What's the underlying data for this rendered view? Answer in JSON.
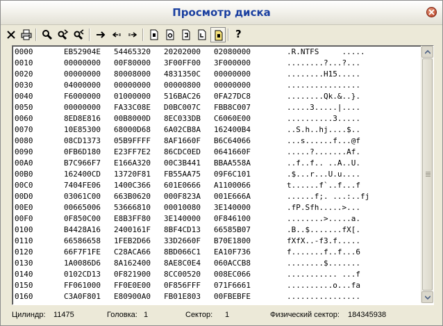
{
  "window": {
    "title": "Просмотр диска"
  },
  "toolbar": {
    "buttons": [
      {
        "name": "close-file-button",
        "icon": "x-icon"
      },
      {
        "name": "print-button",
        "icon": "printer-icon"
      },
      {
        "name": "search-button",
        "icon": "magnifier-icon"
      },
      {
        "name": "search-next-button",
        "icon": "magnifier-next-icon"
      },
      {
        "name": "search-prev-button",
        "icon": "magnifier-prev-icon"
      },
      {
        "name": "goto-button",
        "icon": "arrow-right-icon"
      },
      {
        "name": "back-button",
        "icon": "arrow-back-icon"
      },
      {
        "name": "forward-button",
        "icon": "arrow-forward-icon"
      },
      {
        "name": "view-mode-1-button",
        "icon": "page-icon"
      },
      {
        "name": "view-mode-2-button",
        "icon": "page-icon"
      },
      {
        "name": "view-mode-3-button",
        "icon": "page-icon"
      },
      {
        "name": "view-mode-4-button",
        "icon": "page-icon"
      },
      {
        "name": "view-mode-5-button",
        "icon": "page-icon"
      },
      {
        "name": "help-button",
        "icon": "question-icon"
      }
    ],
    "help_label": "?"
  },
  "hex_rows": [
    {
      "offset": "0000",
      "h1": "EB52904E",
      "h2": "54465320",
      "h3": "20202000",
      "h4": "02080000",
      "ascii": ".R.NTFS     ....."
    },
    {
      "offset": "0010",
      "h1": "00000000",
      "h2": "00F80000",
      "h3": "3F00FF00",
      "h4": "3F000000",
      "ascii": "........?...?..."
    },
    {
      "offset": "0020",
      "h1": "00000000",
      "h2": "80008000",
      "h3": "4831350C",
      "h4": "00000000",
      "ascii": "........H15....."
    },
    {
      "offset": "0030",
      "h1": "04000000",
      "h2": "00000000",
      "h3": "00000800",
      "h4": "00000000",
      "ascii": "................"
    },
    {
      "offset": "0040",
      "h1": "F6000000",
      "h2": "01000000",
      "h3": "516BAC26",
      "h4": "0FA27DC8",
      "ascii": "........Qk.&..}."
    },
    {
      "offset": "0050",
      "h1": "00000000",
      "h2": "FA33C08E",
      "h3": "D0BC007C",
      "h4": "FBB8C007",
      "ascii": ".....3.....|...."
    },
    {
      "offset": "0060",
      "h1": "8ED8E816",
      "h2": "00B8000D",
      "h3": "8EC033DB",
      "h4": "C6060E00",
      "ascii": "..........3....."
    },
    {
      "offset": "0070",
      "h1": "10E85300",
      "h2": "68000D68",
      "h3": "6A02CB8A",
      "h4": "162400B4",
      "ascii": "..S.h..hj....$.."
    },
    {
      "offset": "0080",
      "h1": "08CD1373",
      "h2": "05B9FFFF",
      "h3": "8AF1660F",
      "h4": "B6C64066",
      "ascii": "...s......f...@f"
    },
    {
      "offset": "0090",
      "h1": "0FB6D180",
      "h2": "E23FF7E2",
      "h3": "86CDC0ED",
      "h4": "0641660F",
      "ascii": ".....?.......Af."
    },
    {
      "offset": "00A0",
      "h1": "B7C966F7",
      "h2": "E166A320",
      "h3": "00C3B441",
      "h4": "BBAA558A",
      "ascii": "..f..f.. ..A..U."
    },
    {
      "offset": "00B0",
      "h1": "162400CD",
      "h2": "13720F81",
      "h3": "FB55AA75",
      "h4": "09F6C101",
      "ascii": ".$...r...U.u...."
    },
    {
      "offset": "00C0",
      "h1": "7404FE06",
      "h2": "1400C366",
      "h3": "601E0666",
      "h4": "A1100066",
      "ascii": "t......f`..f...f"
    },
    {
      "offset": "00D0",
      "h1": "03061C00",
      "h2": "663B0620",
      "h3": "000F823A",
      "h4": "001E666A",
      "ascii": "......f;. ...:..fj"
    },
    {
      "offset": "00E0",
      "h1": "00665006",
      "h2": "53666810",
      "h3": "00010080",
      "h4": "3E140000",
      "ascii": ".fP.Sfh.....>..."
    },
    {
      "offset": "00F0",
      "h1": "0F850C00",
      "h2": "E8B3FF80",
      "h3": "3E140000",
      "h4": "0F846100",
      "ascii": "........>.....a."
    },
    {
      "offset": "0100",
      "h1": "B4428A16",
      "h2": "2400161F",
      "h3": "8BF4CD13",
      "h4": "66585B07",
      "ascii": ".B..$.......fX[."
    },
    {
      "offset": "0110",
      "h1": "66586658",
      "h2": "1FEB2D66",
      "h3": "33D2660F",
      "h4": "B70E1800",
      "ascii": "fXfX..-f3.f....."
    },
    {
      "offset": "0120",
      "h1": "66F7F1FE",
      "h2": "C28ACA66",
      "h3": "8BD066C1",
      "h4": "EA10F736",
      "ascii": "f.......f..f...6"
    },
    {
      "offset": "0130",
      "h1": "1A0086D6",
      "h2": "8A162400",
      "h3": "8AE8C0E4",
      "h4": "060ACCB8",
      "ascii": "........$......."
    },
    {
      "offset": "0140",
      "h1": "0102CD13",
      "h2": "0F821900",
      "h3": "8CC00520",
      "h4": "008EC066",
      "ascii": "........... ...f"
    },
    {
      "offset": "0150",
      "h1": "FF061000",
      "h2": "FF0E0E00",
      "h3": "0F856FFF",
      "h4": "071F6661",
      "ascii": "..........o...fa"
    },
    {
      "offset": "0160",
      "h1": "C3A0F801",
      "h2": "E80900A0",
      "h3": "FB01E803",
      "h4": "00FBEBFE",
      "ascii": "................"
    }
  ],
  "status": {
    "cylinder_label": "Цилиндр:",
    "cylinder_value": "11475",
    "head_label": "Головка:",
    "head_value": "1",
    "sector_label": "Сектор:",
    "sector_value": "1",
    "physical_sector_label": "Физический сектор:",
    "physical_sector_value": "184345938"
  }
}
